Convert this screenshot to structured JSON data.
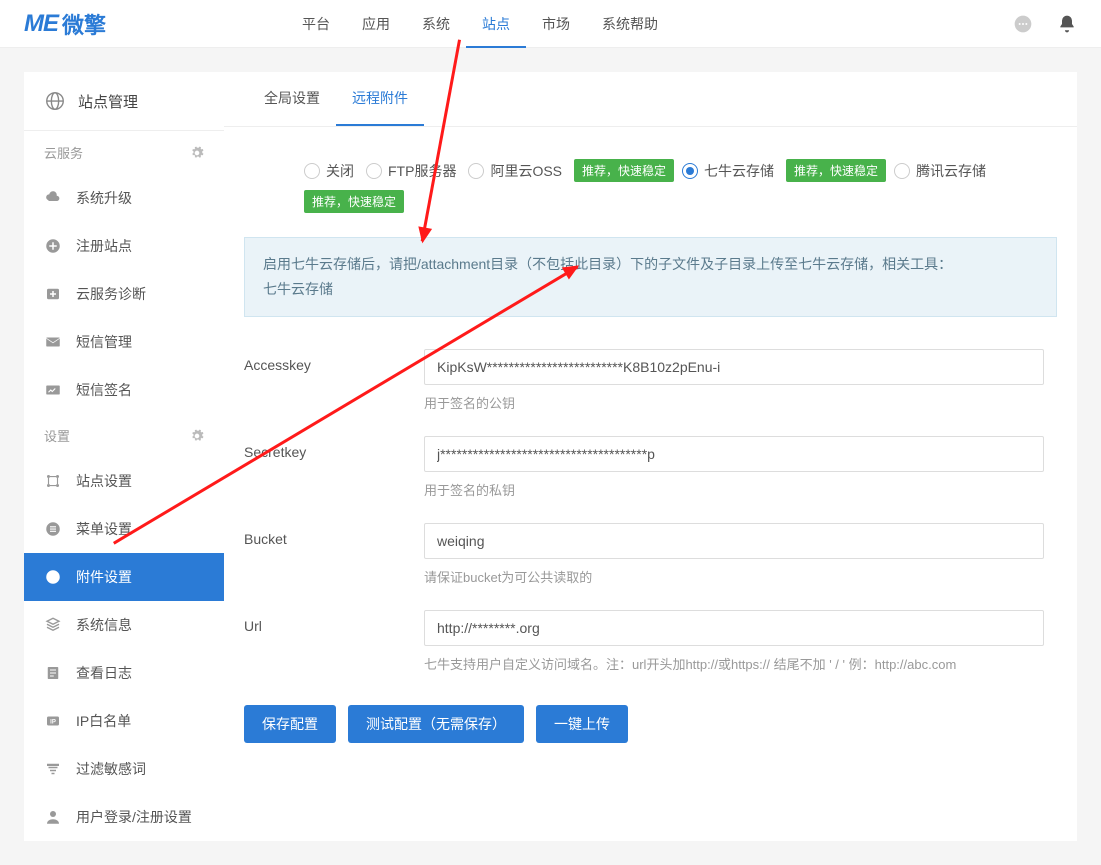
{
  "logo": {
    "mark": "ME",
    "text": "微擎"
  },
  "topnav": [
    "平台",
    "应用",
    "系统",
    "站点",
    "市场",
    "系统帮助"
  ],
  "topnav_active": 3,
  "sidebar": {
    "title": "站点管理",
    "section1": "云服务",
    "items1": [
      "系统升级",
      "注册站点",
      "云服务诊断",
      "短信管理",
      "短信签名"
    ],
    "section2": "设置",
    "items2": [
      "站点设置",
      "菜单设置",
      "附件设置",
      "系统信息",
      "查看日志",
      "IP白名单",
      "过滤敏感词",
      "用户登录/注册设置"
    ],
    "active2": 2
  },
  "tabs": {
    "items": [
      "全局设置",
      "远程附件"
    ],
    "active": 1
  },
  "radio": {
    "options": [
      "关闭",
      "FTP服务器",
      "阿里云OSS",
      "七牛云存储",
      "腾讯云存储"
    ],
    "selected": 3,
    "badge": "推荐，快速稳定",
    "badged": [
      2,
      3,
      4
    ]
  },
  "info": {
    "text": "启用七牛云存储后，请把/attachment目录（不包括此目录）下的子文件及子目录上传至七牛云存储，相关工具：",
    "link": "七牛云存储"
  },
  "fields": {
    "accesskey": {
      "label": "Accesskey",
      "value": "KipKsW*************************K8B10z2pEnu-i",
      "help": "用于签名的公钥"
    },
    "secretkey": {
      "label": "Secretkey",
      "value": "j**************************************p",
      "help": "用于签名的私钥"
    },
    "bucket": {
      "label": "Bucket",
      "value": "weiqing",
      "help": "请保证bucket为可公共读取的"
    },
    "url": {
      "label": "Url",
      "value": "http://********.org",
      "help": "七牛支持用户自定义访问域名。注：url开头加http://或https://  结尾不加  ' / '   例：http://abc.com"
    }
  },
  "buttons": {
    "save": "保存配置",
    "test": "测试配置（无需保存）",
    "upload": "一键上传"
  }
}
